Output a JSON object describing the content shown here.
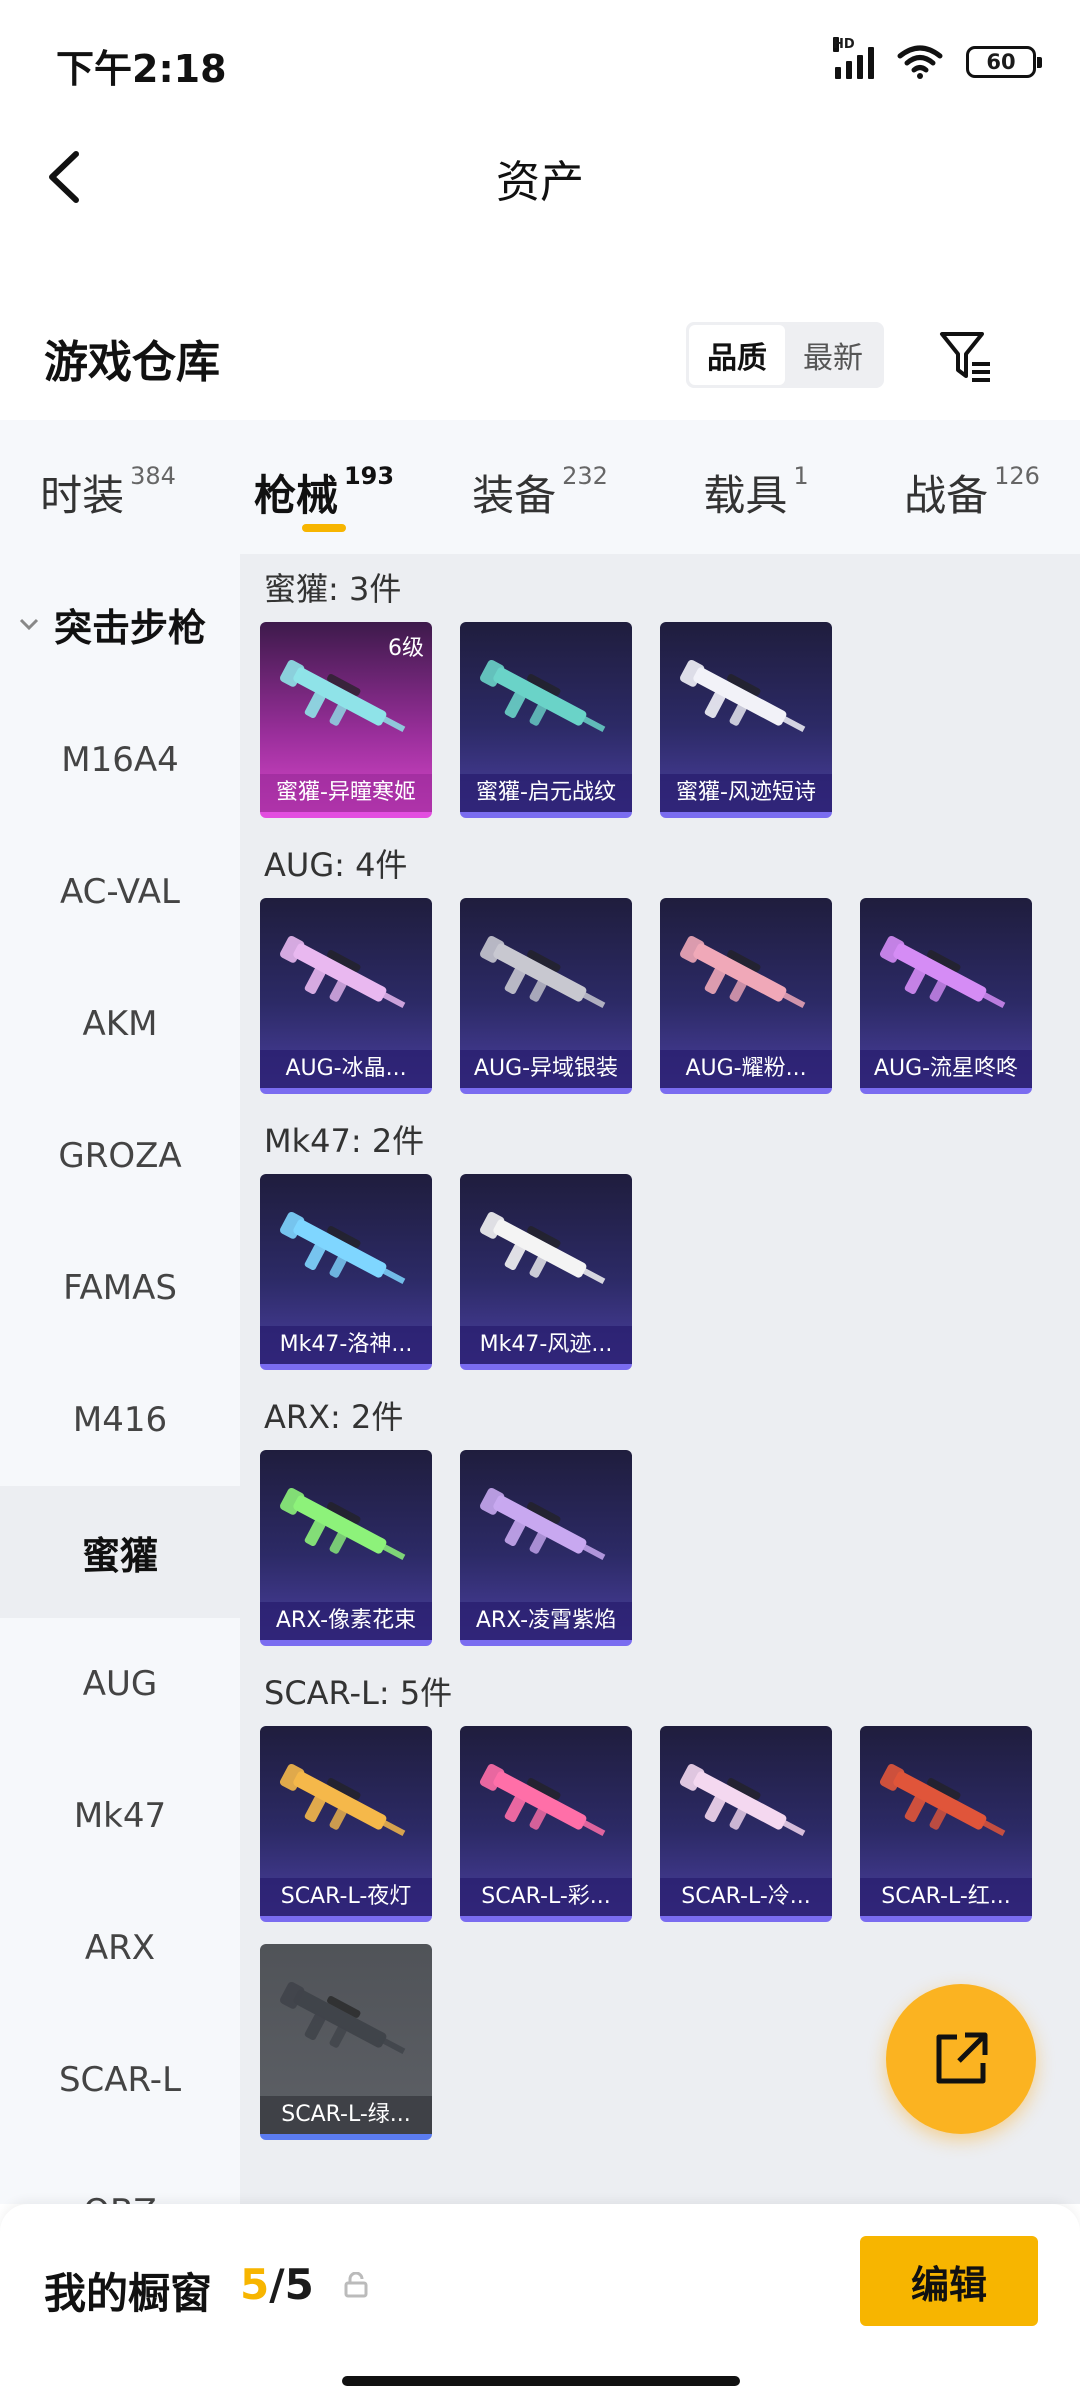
{
  "status": {
    "time": "下午2:18",
    "battery": "60",
    "net_badge": "HD"
  },
  "header": {
    "title": "资产"
  },
  "warehouse": {
    "title": "游戏仓库",
    "sort_options": [
      "品质",
      "最新"
    ],
    "sort_selected": "品质"
  },
  "tabs": [
    {
      "label": "时装",
      "count": "384"
    },
    {
      "label": "枪械",
      "count": "193",
      "active": true
    },
    {
      "label": "装备",
      "count": "232"
    },
    {
      "label": "载具",
      "count": "1"
    },
    {
      "label": "战备",
      "count": "126"
    }
  ],
  "sidebar": {
    "group": "突击步枪",
    "items": [
      "M16A4",
      "AC-VAL",
      "AKM",
      "GROZA",
      "FAMAS",
      "M416",
      "蜜獾",
      "AUG",
      "Mk47",
      "ARX",
      "SCAR-L",
      "QBZ"
    ],
    "selected": "蜜獾"
  },
  "sections": [
    {
      "title": "蜜獾: 3件",
      "items": [
        {
          "label": "蜜獾-异瞳寒姬",
          "level": "6级",
          "style": "pink"
        },
        {
          "label": "蜜獾-启元战纹"
        },
        {
          "label": "蜜獾-风迹短诗"
        }
      ]
    },
    {
      "title": "AUG: 4件",
      "items": [
        {
          "label": "AUG-冰晶..."
        },
        {
          "label": "AUG-异域银装"
        },
        {
          "label": "AUG-耀粉..."
        },
        {
          "label": "AUG-流星咚咚"
        }
      ]
    },
    {
      "title": "Mk47: 2件",
      "items": [
        {
          "label": "Mk47-洛神..."
        },
        {
          "label": "Mk47-风迹..."
        }
      ]
    },
    {
      "title": "ARX: 2件",
      "items": [
        {
          "label": "ARX-像素花束"
        },
        {
          "label": "ARX-凌霄紫焰"
        }
      ]
    },
    {
      "title": "SCAR-L: 5件",
      "items": [
        {
          "label": "SCAR-L-夜灯"
        },
        {
          "label": "SCAR-L-彩..."
        },
        {
          "label": "SCAR-L-冷..."
        },
        {
          "label": "SCAR-L-红..."
        },
        {
          "label": "SCAR-L-绿...",
          "style": "gray"
        }
      ]
    }
  ],
  "bottom": {
    "title": "我的橱窗",
    "count_current": "5",
    "count_total": "/5",
    "edit_label": "编辑"
  },
  "colors": {
    "accent": "#f7b500",
    "card_purple": "#2c2a66",
    "card_pink": "#d546c8"
  },
  "icons": [
    "back-arrow-icon",
    "filter-icon",
    "share-icon",
    "lock-icon",
    "wifi-icon",
    "signal-icon",
    "battery-icon"
  ]
}
